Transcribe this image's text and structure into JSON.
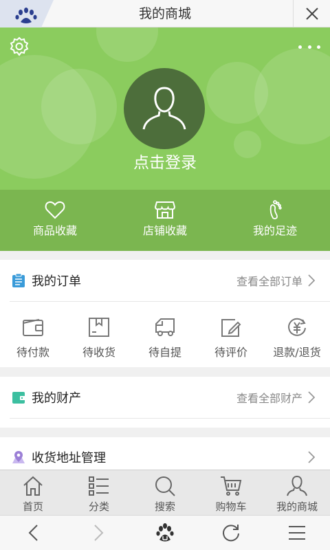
{
  "topbar": {
    "title": "我的商城"
  },
  "hero": {
    "login_text": "点击登录"
  },
  "favorites": [
    {
      "label": "商品收藏",
      "icon": "heart-icon"
    },
    {
      "label": "店铺收藏",
      "icon": "store-icon"
    },
    {
      "label": "我的足迹",
      "icon": "footprint-icon"
    }
  ],
  "orders_section": {
    "title": "我的订单",
    "link": "查看全部订单",
    "items": [
      {
        "label": "待付款",
        "icon": "wallet-icon"
      },
      {
        "label": "待收货",
        "icon": "package-icon"
      },
      {
        "label": "待自提",
        "icon": "truck-icon"
      },
      {
        "label": "待评价",
        "icon": "edit-icon"
      },
      {
        "label": "退款/退货",
        "icon": "refund-icon"
      }
    ]
  },
  "assets_section": {
    "title": "我的财产",
    "link": "查看全部财产"
  },
  "address_section": {
    "title": "收货地址管理"
  },
  "tabbar": [
    {
      "label": "首页",
      "icon": "home-icon"
    },
    {
      "label": "分类",
      "icon": "list-icon"
    },
    {
      "label": "搜索",
      "icon": "search-icon"
    },
    {
      "label": "购物车",
      "icon": "cart-icon"
    },
    {
      "label": "我的商城",
      "icon": "user-icon"
    }
  ],
  "colors": {
    "hero_green": "#8bcc5e",
    "avatar_bg": "#4d6e3b",
    "orders_icon": "#3a9bd9",
    "assets_icon": "#3cbfa0",
    "address_icon": "#9b7fd6"
  }
}
